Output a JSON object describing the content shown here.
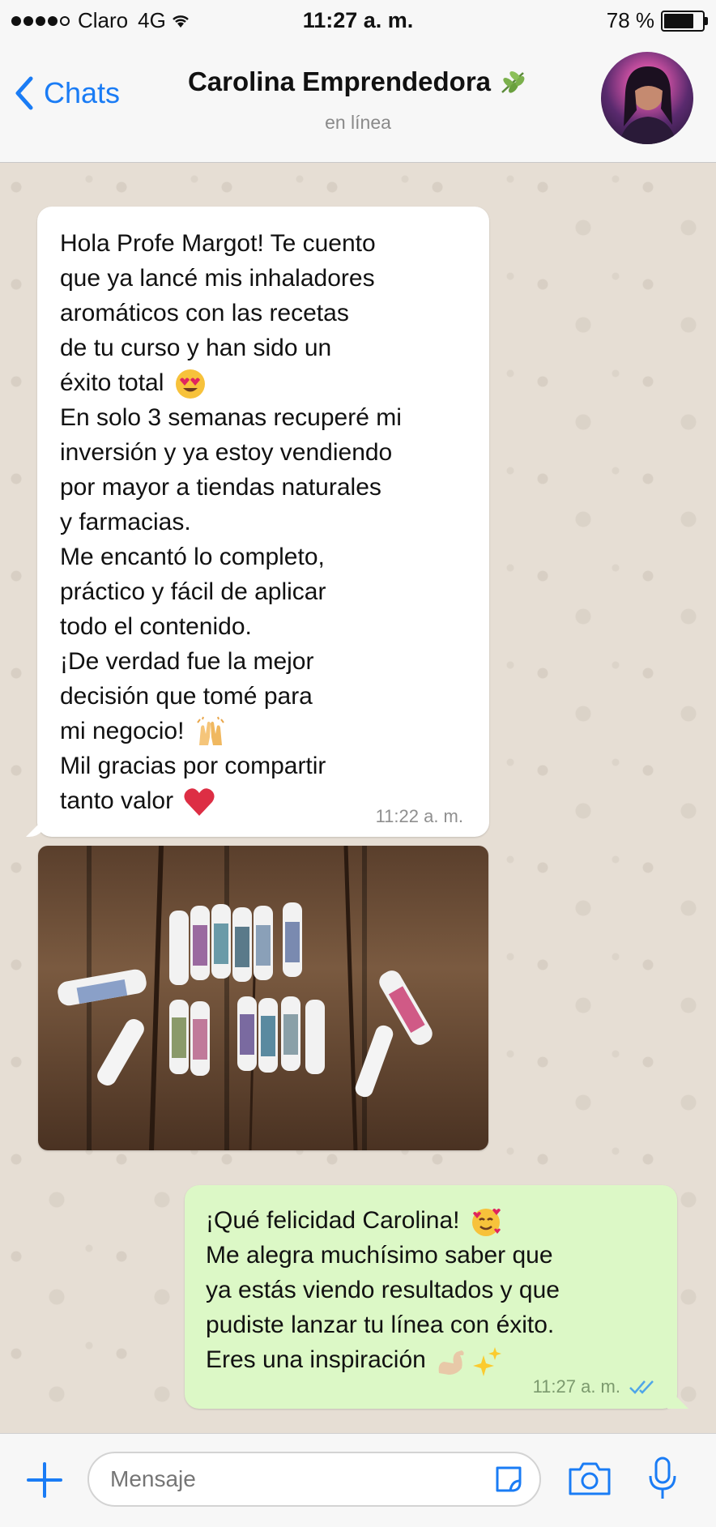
{
  "status_bar": {
    "carrier": "Claro",
    "network": "4G",
    "time": "11:27 a. m.",
    "battery": "78 %"
  },
  "nav": {
    "back_label": "Chats",
    "contact_name": "Carolina Emprendedora",
    "status": "en línea"
  },
  "messages": {
    "incoming": {
      "lines": [
        "Hola Profe Margot! Te cuento",
        "que ya lancé mis inhaladores",
        "aromáticos con las recetas",
        "de tu curso y han sido un",
        "éxito total",
        "En solo 3 semanas recuperé mi",
        "inversión y ya estoy vendiendo",
        "por mayor a tiendas naturales",
        "y farmacias.",
        "Me encantó lo completo,",
        "práctico y fácil de aplicar",
        "todo el contenido.",
        "¡De verdad fue la mejor",
        "decisión que tomé para",
        "mi negocio!",
        "Mil gracias por compartir",
        "tanto valor"
      ],
      "time": "11:22 a. m."
    },
    "outgoing": {
      "lines": [
        "¡Qué felicidad Carolina!",
        "Me alegra muchísimo saber que",
        "ya estás viendo resultados y que",
        "pudiste lanzar tu línea con éxito.",
        "Eres una inspiración"
      ],
      "time": "11:27 a. m."
    }
  },
  "input": {
    "placeholder": "Mensaje"
  },
  "colors": {
    "accent": "#1a7cf5",
    "outgoing_bubble": "#dcf8c6",
    "incoming_bubble": "#ffffff",
    "chat_background": "#e6ded4"
  },
  "icons": [
    "back-chevron-icon",
    "leaf-icon",
    "plus-icon",
    "sticker-icon",
    "camera-icon",
    "microphone-icon",
    "double-check-icon"
  ]
}
